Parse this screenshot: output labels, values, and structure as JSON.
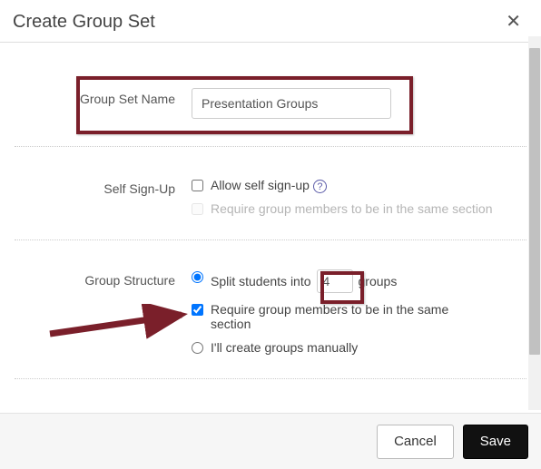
{
  "header": {
    "title": "Create Group Set"
  },
  "name_row": {
    "label": "Group Set Name",
    "value": "Presentation Groups"
  },
  "self_signup": {
    "label": "Self Sign-Up",
    "allow_label": "Allow self sign-up",
    "allow_checked": false,
    "require_same_section_label": "Require group members to be in the same section",
    "require_same_section_checked": false
  },
  "structure": {
    "label": "Group Structure",
    "selected": "split",
    "split": {
      "prefix": "Split students into",
      "count": "4",
      "suffix": "groups",
      "require_same_section_label": "Require group members to be in the same section",
      "require_same_section_checked": true
    },
    "manual_label": "I'll create groups manually"
  },
  "footer": {
    "cancel": "Cancel",
    "save": "Save"
  }
}
